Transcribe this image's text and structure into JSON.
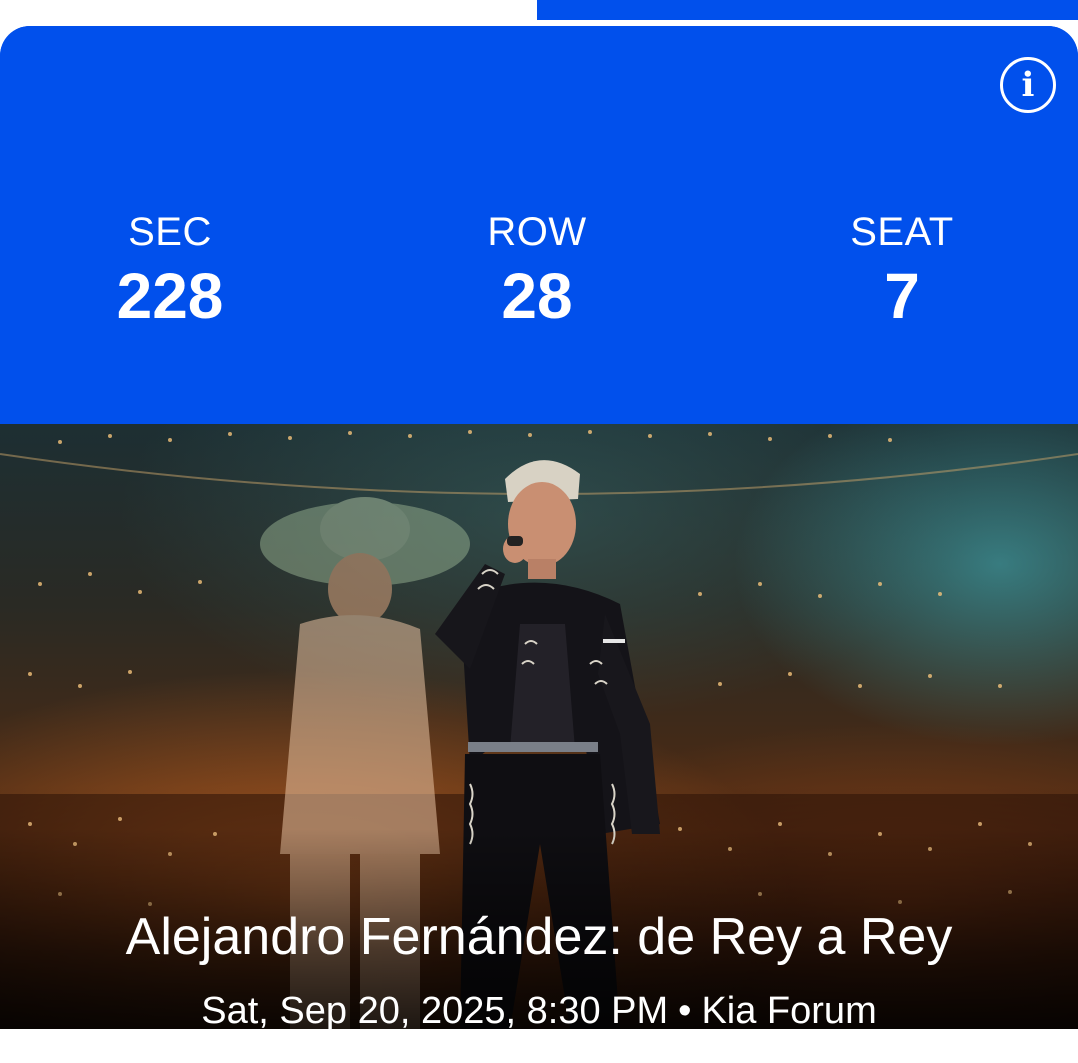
{
  "colors": {
    "ticket_blue": "#0150ec",
    "text": "#ffffff"
  },
  "header": {
    "info_icon": "info-circle-icon",
    "info_glyph": "i"
  },
  "seating": {
    "section": {
      "label": "SEC",
      "value": "228"
    },
    "row": {
      "label": "ROW",
      "value": "28"
    },
    "seat": {
      "label": "SEAT",
      "value": "7"
    }
  },
  "event": {
    "title": "Alejandro Fernández: de Rey a Rey",
    "datetime": "Sat, Sep 20, 2025, 8:30 PM",
    "separator": "•",
    "venue": "Kia Forum"
  }
}
